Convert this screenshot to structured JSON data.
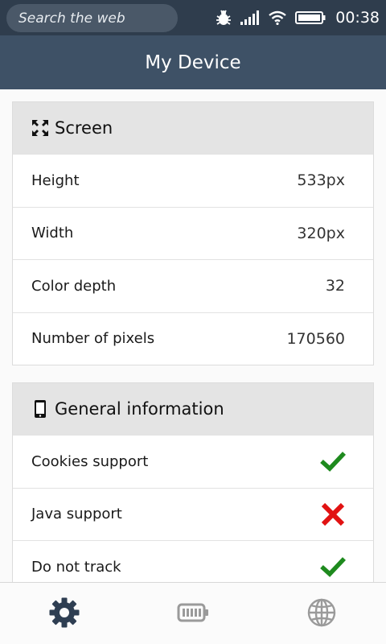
{
  "status_bar": {
    "search_placeholder": "Search the web",
    "time": "00:38",
    "icons": [
      "bug-icon",
      "signal-icon",
      "wifi-icon",
      "battery-icon"
    ]
  },
  "header": {
    "title": "My Device"
  },
  "screen_section": {
    "title": "Screen",
    "icon": "fullscreen-icon",
    "rows": [
      {
        "label": "Height",
        "value": "533px"
      },
      {
        "label": "Width",
        "value": "320px"
      },
      {
        "label": "Color depth",
        "value": "32"
      },
      {
        "label": "Number of pixels",
        "value": "170560"
      }
    ]
  },
  "general_section": {
    "title": "General information",
    "icon": "phone-icon",
    "rows": [
      {
        "label": "Cookies support",
        "status": "yes"
      },
      {
        "label": "Java support",
        "status": "no"
      },
      {
        "label": "Do not track",
        "status": "yes"
      }
    ]
  },
  "colors": {
    "status_bar_bg": "#2f3d4d",
    "header_bg": "#3e5166",
    "check_green": "#1e8a1e",
    "cross_red": "#e11212",
    "tab_active": "#2e3e52",
    "tab_inactive": "#9a9a9a"
  },
  "tabs": [
    {
      "icon": "gear-icon",
      "active": true
    },
    {
      "icon": "battery-icon",
      "active": false
    },
    {
      "icon": "globe-icon",
      "active": false
    }
  ]
}
